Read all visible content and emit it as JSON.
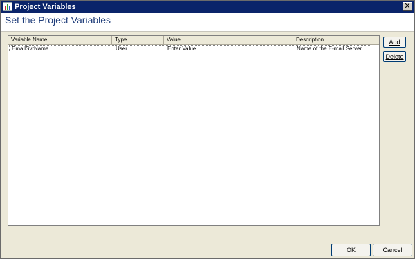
{
  "window": {
    "title": "Project Variables",
    "close_glyph": "✕"
  },
  "header": {
    "title": "Set the Project Variables"
  },
  "table": {
    "columns": [
      "Variable Name",
      "Type",
      "Value",
      "Description"
    ],
    "rows": [
      [
        "EmailSvrName",
        "User",
        "Enter Value",
        "Name of the E-mail Server"
      ]
    ]
  },
  "buttons": {
    "add": "Add",
    "delete": "Delete",
    "ok": "OK",
    "cancel": "Cancel"
  },
  "icons": {
    "app": "chart-icon",
    "close": "close-icon"
  },
  "colors": {
    "titlebar": "#0a246a",
    "header_title": "#1f3d7a",
    "dialog_bg": "#ece9d8"
  }
}
